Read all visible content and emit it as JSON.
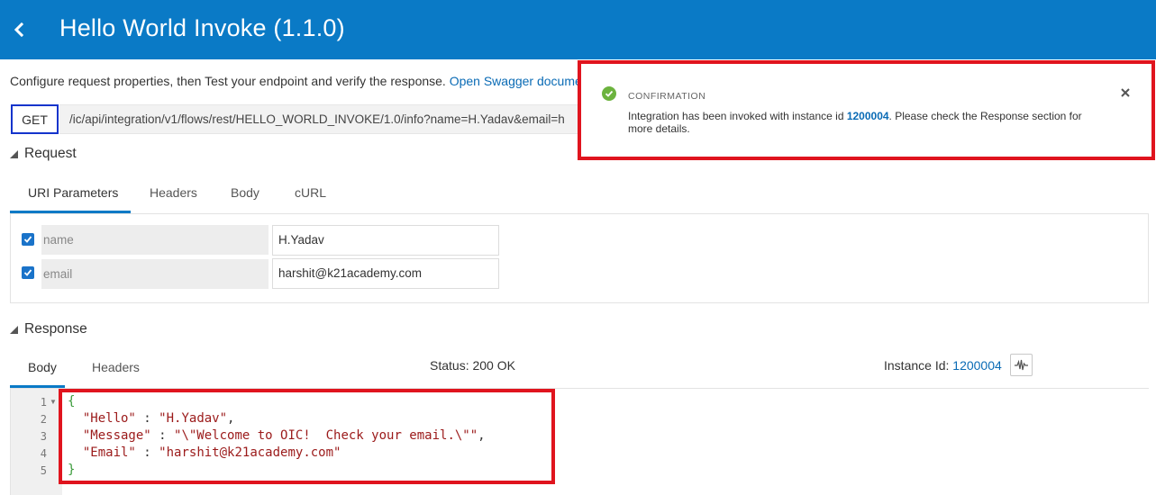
{
  "header": {
    "title": "Hello World Invoke (1.1.0)"
  },
  "intro": {
    "text": "Configure request properties, then Test your endpoint and verify the response. ",
    "link": "Open Swagger docume"
  },
  "request_line": {
    "method": "GET",
    "url": "/ic/api/integration/v1/flows/rest/HELLO_WORLD_INVOKE/1.0/info?name=H.Yadav&email=h"
  },
  "request": {
    "section_title": "Request",
    "tabs": [
      "URI Parameters",
      "Headers",
      "Body",
      "cURL"
    ],
    "active_tab": "URI Parameters",
    "params": [
      {
        "checked": true,
        "name": "name",
        "value": "H.Yadav"
      },
      {
        "checked": true,
        "name": "email",
        "value": "harshit@k21academy.com"
      }
    ]
  },
  "response": {
    "section_title": "Response",
    "tabs": [
      "Body",
      "Headers"
    ],
    "active_tab": "Body",
    "status_label": "Status: ",
    "status_value": "200 OK",
    "instance_label": "Instance Id: ",
    "instance_value": "1200004",
    "line_numbers": [
      "1",
      "2",
      "3",
      "4",
      "5"
    ],
    "body_lines": {
      "open": "{",
      "hello_key": "\"Hello\"",
      "hello_val": "\"H.Yadav\"",
      "message_key": "\"Message\"",
      "message_val": "\"\\\"Welcome to OIC!  Check your email.\\\"\"",
      "email_key": "\"Email\"",
      "email_val": "\"harshit@k21academy.com\"",
      "close": "}"
    }
  },
  "toast": {
    "label": "CONFIRMATION",
    "message_before": "Integration has been invoked with instance id ",
    "instance_id": "1200004",
    "message_after": ". Please check the Response section for more details."
  },
  "icons": {
    "back": "chevron-left-icon",
    "check": "checkmark-icon",
    "ok": "success-circle-icon",
    "close": "close-icon",
    "wave": "activity-stream-icon"
  },
  "colors": {
    "header_bg": "#0a7ac6",
    "accent": "#0a7ac6",
    "highlight": "#e0141e",
    "success": "#6cb33e",
    "string": "#9b1a1a",
    "brace": "#3a9a3a"
  }
}
